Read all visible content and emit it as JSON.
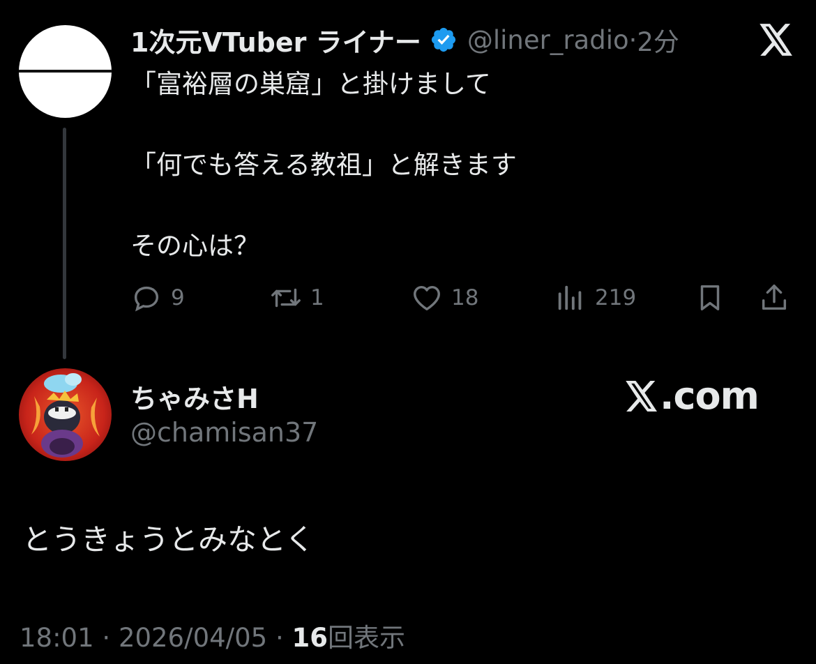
{
  "parent": {
    "display_name": "1次元VTuber ライナー",
    "handle": "@liner_radio",
    "separator": " · ",
    "time_ago": "2分",
    "body_lines": [
      "「富裕層の巣窟」と掛けまして",
      "",
      "「何でも答える教祖」と解きます",
      "",
      "その心は？"
    ],
    "actions": {
      "replies": "9",
      "reposts": "1",
      "likes": "18",
      "views": "219"
    }
  },
  "quote": {
    "display_name": "ちゃみさH",
    "handle": "@chamisan37",
    "site": ".com"
  },
  "reply_text": "とうきょうとみなとく",
  "meta": {
    "time": "18:01",
    "date": "2026/04/05",
    "separator": " · ",
    "view_count": "16",
    "view_label": "回表示"
  },
  "colors": {
    "background": "#000000",
    "text_primary": "#e7e9ea",
    "text_muted": "#71767b",
    "verified": "#1d9bf0"
  }
}
